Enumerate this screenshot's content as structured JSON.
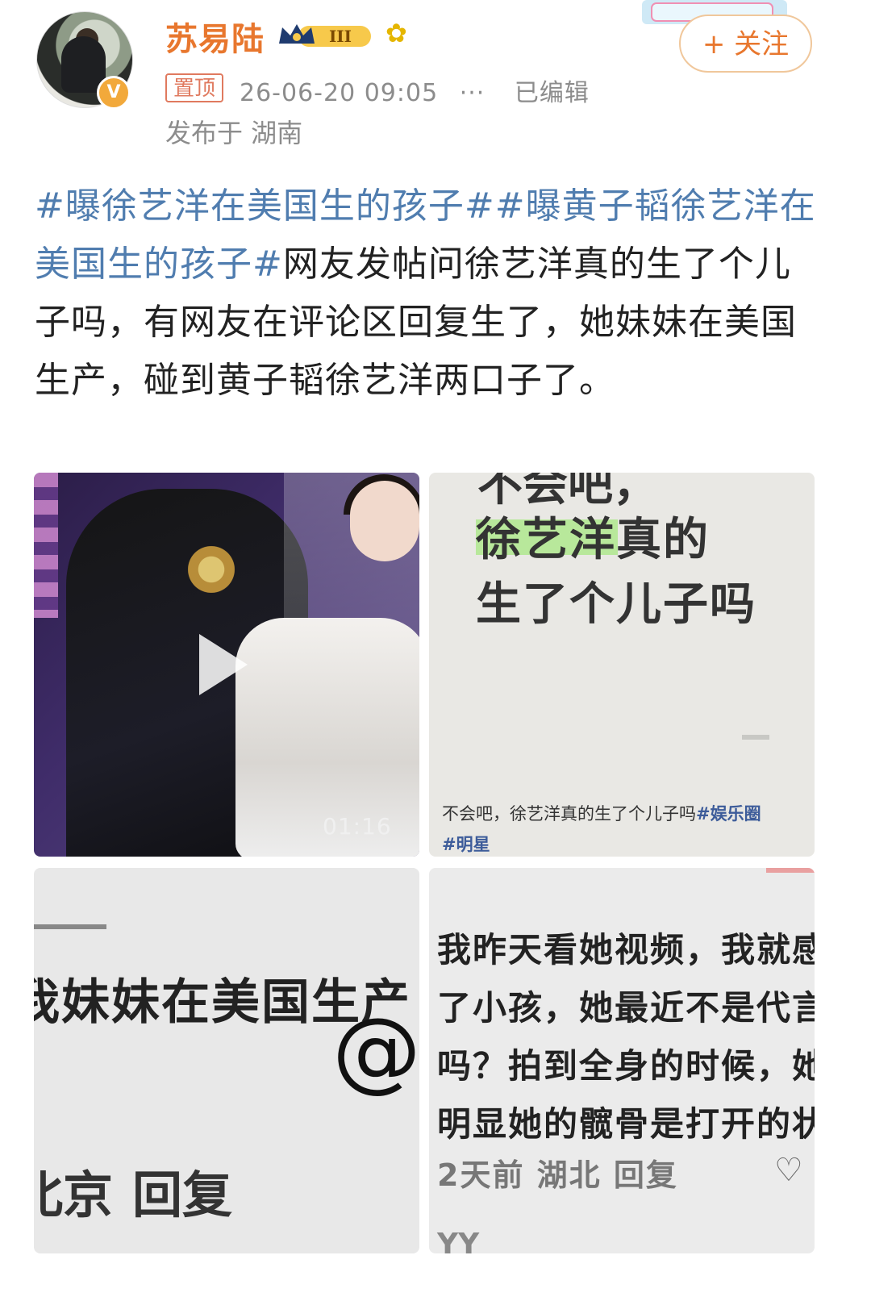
{
  "header": {
    "username": "苏易陆",
    "level_badge": "III",
    "verified_badge": "V",
    "pinned_label": "置顶",
    "timestamp": "26-06-20 09:05",
    "more": "···",
    "edited": "已编辑",
    "location": "发布于 湖南",
    "follow_label": "+ 关注"
  },
  "post": {
    "tag1": "#曝徐艺洋在美国生的孩子#",
    "tag2": "#曝黄子韬徐艺洋在美国生的孩子#",
    "body": "网友发帖问徐艺洋真的生了个儿子吗，有网友在评论区回复生了，她妹妹在美国生产，碰到黄子韬徐艺洋两口子了。"
  },
  "media": {
    "video_duration": "01:16",
    "tile2": {
      "top_text": "不会吧，",
      "line1": "徐艺洋真的",
      "line2": "生了个儿子吗",
      "caption": "不会吧，徐艺洋真的生了个儿子吗",
      "caption_tag1": "#娱乐圈",
      "caption_tag2": "#明星"
    },
    "tile3": {
      "line": "我妹妹在美国生产",
      "at": "@",
      "bottom_loc": "北京",
      "bottom_reply": "回复"
    },
    "tile4": {
      "line1": "我昨天看她视频，我就感",
      "line2": "了小孩，她最近不是代言",
      "line3": "吗？拍到全身的时候，她",
      "line4": "明显她的髋骨是打开的状",
      "meta": "2天前  湖北  回复",
      "heart": "♡",
      "footer": "YY"
    }
  },
  "colors": {
    "accent": "#e8772e",
    "link": "#507daf",
    "pinned": "#e07a5f"
  }
}
